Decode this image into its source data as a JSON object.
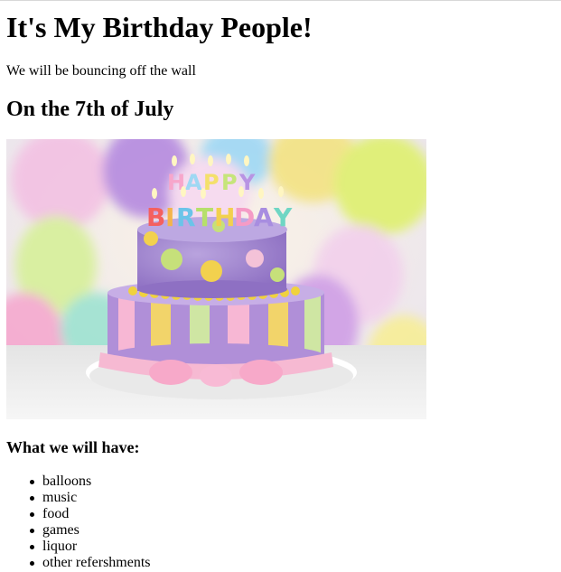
{
  "page": {
    "title": "It's My Birthday People!",
    "subtitle": "We will be bouncing off the wall",
    "date_heading": "On the 7th of July",
    "image": {
      "icon": "birthday-cake-photo",
      "description_words": [
        "HAPPY",
        "BIRTHDAY"
      ]
    },
    "list_heading": "What we will have:",
    "items": [
      "balloons",
      "music",
      "food",
      "games",
      "liquor",
      "other refershments"
    ]
  },
  "colors": {
    "text": "#000000",
    "background": "#ffffff"
  }
}
